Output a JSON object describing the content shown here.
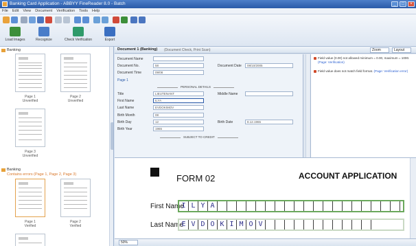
{
  "window": {
    "title": "Banking Card Application - ABBYY FineReader 8.0 - Batch",
    "buttons": [
      "_",
      "□",
      "×"
    ]
  },
  "menu": [
    "File",
    "Edit",
    "View",
    "Document",
    "Verification",
    "Tools",
    "Help"
  ],
  "toolbar": {
    "buttons": [
      {
        "label": "Load Images",
        "icon": "scan-icon",
        "color": "#3d8f3a"
      },
      {
        "label": "Recognize",
        "icon": "recognize-icon",
        "color": "#4a7dc9"
      },
      {
        "label": "Check Verification",
        "icon": "verify-icon",
        "color": "#2f9a6a"
      },
      {
        "label": "Export",
        "icon": "export-icon",
        "color": "#3a6fc1"
      }
    ]
  },
  "left_pane": {
    "batch1": {
      "title": "Banking",
      "pages": [
        {
          "caption": "Page 1",
          "sub": "Unverified"
        },
        {
          "caption": "Page 2",
          "sub": "Unverified"
        },
        {
          "caption": "Page 3",
          "sub": "Unverified"
        }
      ]
    },
    "batch2": {
      "title": "Banking",
      "status": "Contains errors (Page 1, Page 2, Page 3)",
      "pages": [
        {
          "caption": "Page 1",
          "sub": "Verified"
        },
        {
          "caption": "Page 2",
          "sub": "Verified"
        }
      ]
    }
  },
  "doc_tab": {
    "title": "Document 1 (Banking)",
    "subtitle": "(Document Check, Print Scan)",
    "right_controls": [
      "Zoom",
      "Layout"
    ]
  },
  "form": {
    "fields_top": [
      {
        "label": "Document Name",
        "value": ""
      },
      {
        "label": "Document No.",
        "value": "58"
      },
      {
        "label": "Document Date",
        "value": "08/08"
      },
      {
        "label": "Document Time",
        "value": "09/08"
      }
    ],
    "right_top": {
      "label": "Document Date",
      "value": "08/10/2005"
    },
    "page_label": "Page 1",
    "section1": "PERSONAL DETAILS",
    "personal": [
      {
        "label": "Title",
        "value": "LIEUTENANT"
      },
      {
        "label": "First Name",
        "value": "ILYA"
      },
      {
        "label": "Last Name",
        "value": "EVDOKIMOV"
      },
      {
        "label": "Birth Month",
        "value": "08"
      },
      {
        "label": "Birth Day",
        "value": "12"
      },
      {
        "label": "Birth Year",
        "value": "1965"
      }
    ],
    "middle_name": {
      "label": "Middle Name",
      "value": ""
    },
    "birth_date": {
      "label": "Birth Date",
      "value": "8.12.1965"
    },
    "section2": "SUBJECT TO CREDIT"
  },
  "messages": [
    {
      "text": "Field value (0.00) not allowed minimum = 0.00, maximum = 1000.",
      "link": "(Page: Verification)"
    },
    {
      "text": "Field value does not match field format.",
      "link": "(Page: Verification error)"
    }
  ],
  "image": {
    "form_title": "FORM 02",
    "heading": "ACCOUNT APPLICATION",
    "first_name_label": "First Name",
    "first_name_letters": [
      "I",
      "L",
      "Y",
      "A",
      "",
      "",
      "",
      "",
      "",
      "",
      "",
      "",
      "",
      "",
      "",
      "",
      "",
      "",
      "",
      "",
      "",
      "",
      ""
    ],
    "last_name_label": "Last Name",
    "last_name_letters": [
      "E",
      "V",
      "D",
      "O",
      "K",
      "I",
      "M",
      "O",
      "V",
      "",
      "",
      "",
      "",
      "",
      "",
      "",
      "",
      "",
      "",
      ""
    ]
  },
  "statusbar": {
    "zoom": "50%"
  },
  "colors": {
    "accent": "#2a5aa8",
    "field_box": "#6aa85c",
    "error": "#d04a2a"
  }
}
